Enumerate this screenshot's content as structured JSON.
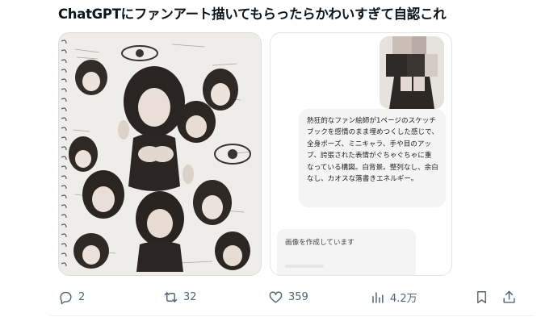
{
  "post": {
    "title": "ChatGPTにファンアート描いてもらったらかわいすぎて自認これ"
  },
  "chat": {
    "prompt_text": "熱狂的なファン絵師が1ページのスケッチブックを感情のまま埋めつくした感じで、全身ポーズ、ミニキャラ、手や目のアップ、誇張された表情がぐちゃぐちゃに重なっている構図。白背景。整列なし、余白なし、カオスな落書きエネルギー。",
    "status_text": "画像を作成しています"
  },
  "actions": {
    "replies": "2",
    "reposts": "32",
    "likes": "359",
    "views": "4.2万"
  },
  "colors": {
    "text": "#0f1419",
    "muted": "#536471",
    "bubble": "#f4f4f4"
  },
  "icons": [
    "reply-icon",
    "repost-icon",
    "like-icon",
    "views-icon",
    "bookmark-icon",
    "share-icon"
  ]
}
